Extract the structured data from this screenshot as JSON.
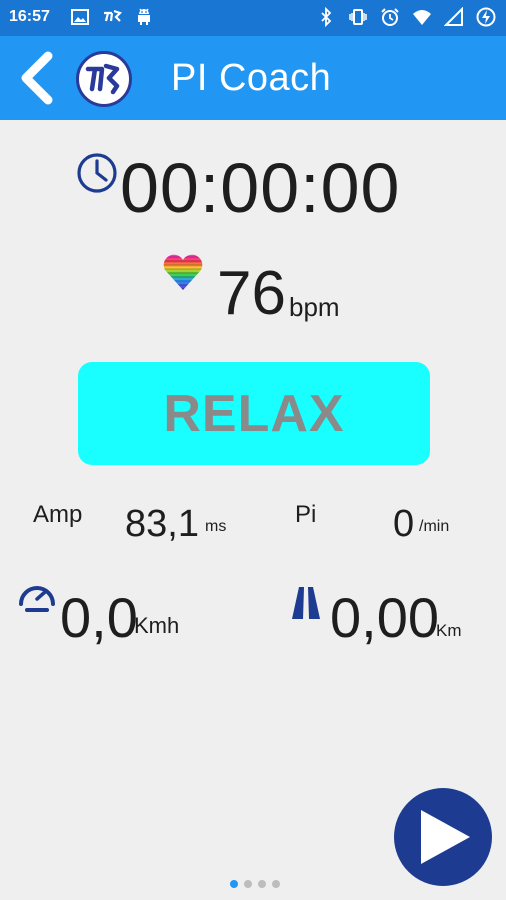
{
  "status_bar": {
    "time": "16:57",
    "left_icons": [
      "image-icon",
      "running-app-icon",
      "android-icon"
    ],
    "right_icons": [
      "bluetooth-icon",
      "vibrate-icon",
      "alarm-icon",
      "wifi-icon",
      "signal-icon",
      "battery-charging-icon"
    ]
  },
  "app_bar": {
    "title": "PI Coach",
    "background": "#2196f3",
    "status_background": "#1976d2"
  },
  "timer": {
    "value": "00:00:00",
    "icon": "clock-icon"
  },
  "heart_rate": {
    "value": "76",
    "unit": "bpm",
    "icon": "rainbow-heart-icon"
  },
  "relax_button": {
    "label": "RELAX",
    "color": "#19ffff",
    "text_color": "#8a8a8a"
  },
  "metrics": {
    "amp": {
      "label": "Amp",
      "value": "83,1",
      "unit": "ms"
    },
    "pi": {
      "label": "Pi",
      "value": "0",
      "unit": "/min"
    },
    "speed": {
      "value": "0,0",
      "unit": "Kmh",
      "icon": "speedometer-icon"
    },
    "distance": {
      "value": "0,00",
      "unit": "Km",
      "icon": "road-icon"
    }
  },
  "play_button": {
    "icon": "play-icon",
    "color": "#1d3b90"
  },
  "pager": {
    "count": 4,
    "active_index": 0
  }
}
